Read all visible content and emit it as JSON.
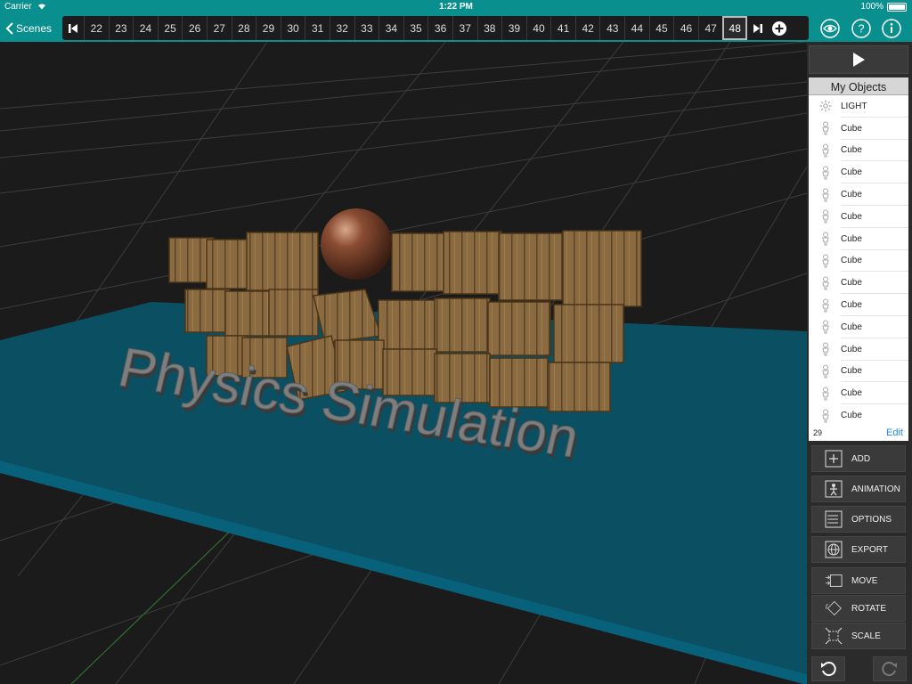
{
  "status": {
    "carrier": "Carrier",
    "time": "1:22 PM",
    "battery": "100%"
  },
  "toolbar": {
    "back_label": "Scenes",
    "frames": [
      "22",
      "23",
      "24",
      "25",
      "26",
      "27",
      "28",
      "29",
      "30",
      "31",
      "32",
      "33",
      "34",
      "35",
      "36",
      "37",
      "38",
      "39",
      "40",
      "41",
      "42",
      "43",
      "44",
      "45",
      "46",
      "47",
      "48"
    ],
    "selected_frame": "48"
  },
  "scene": {
    "text": "Physics Simulation"
  },
  "objects": {
    "title": "My Objects",
    "items": [
      {
        "label": "LIGHT",
        "icon": "light-icon"
      },
      {
        "label": "Cube",
        "icon": "figure-icon"
      },
      {
        "label": "Cube",
        "icon": "figure-icon"
      },
      {
        "label": "Cube",
        "icon": "figure-icon"
      },
      {
        "label": "Cube",
        "icon": "figure-icon"
      },
      {
        "label": "Cube",
        "icon": "figure-icon"
      },
      {
        "label": "Cube",
        "icon": "figure-icon"
      },
      {
        "label": "Cube",
        "icon": "figure-icon"
      },
      {
        "label": "Cube",
        "icon": "figure-icon"
      },
      {
        "label": "Cube",
        "icon": "figure-icon"
      },
      {
        "label": "Cube",
        "icon": "figure-icon"
      },
      {
        "label": "Cube",
        "icon": "figure-icon"
      },
      {
        "label": "Cube",
        "icon": "figure-icon"
      },
      {
        "label": "Cube",
        "icon": "figure-icon"
      },
      {
        "label": "Cube",
        "icon": "figure-icon"
      }
    ],
    "count": "29",
    "edit_label": "Edit"
  },
  "actions": {
    "add": "ADD",
    "animation": "ANIMATION",
    "options": "OPTIONS",
    "export": "EXPORT",
    "move": "MOVE",
    "rotate": "ROTATE",
    "scale": "SCALE"
  },
  "colors": {
    "accent": "#0a8f8f",
    "floor": "#0b4f63",
    "edit_link": "#1e88e5"
  }
}
